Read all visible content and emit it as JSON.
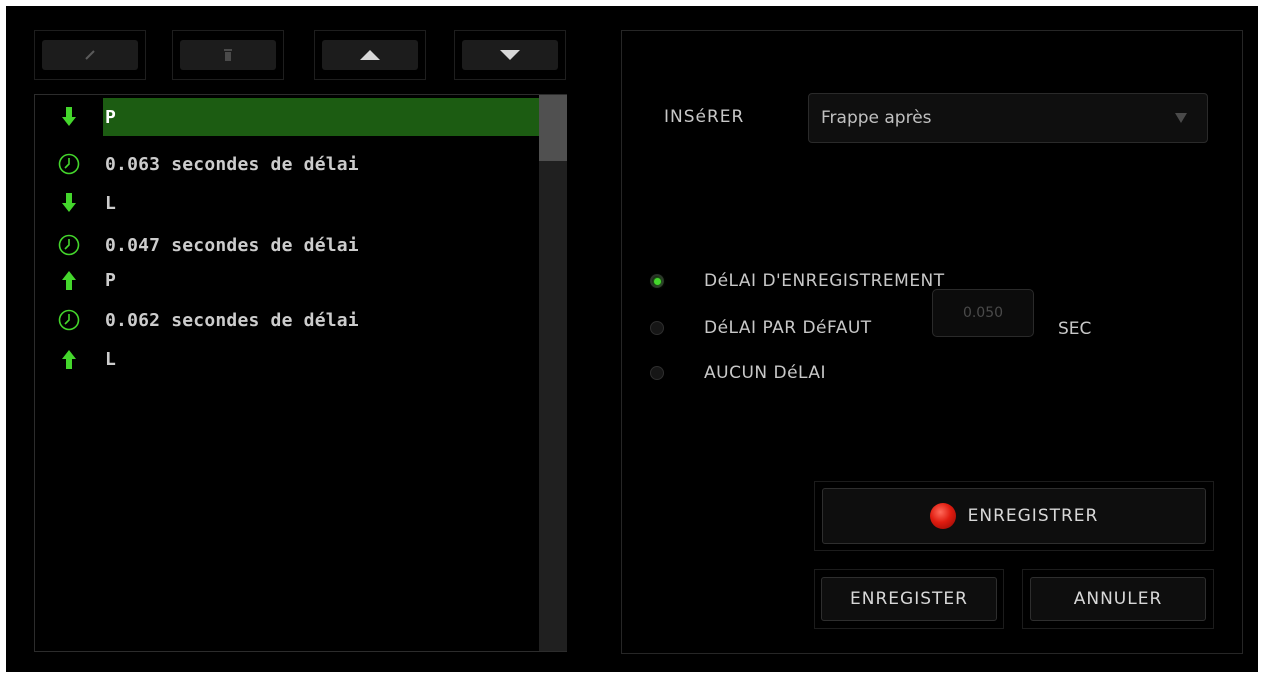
{
  "toolbar": {
    "buttons": [
      {
        "name": "edit",
        "icon": "pencil-icon"
      },
      {
        "name": "delete",
        "icon": "trash-icon"
      },
      {
        "name": "move-up",
        "icon": "arrow-up-icon"
      },
      {
        "name": "move-down",
        "icon": "arrow-down-icon"
      }
    ]
  },
  "macro_list": {
    "items": [
      {
        "icon": "key-down-arrow-icon",
        "text": "P",
        "selected": true
      },
      {
        "icon": "clock-icon",
        "text": "0.063 secondes de délai",
        "selected": false
      },
      {
        "icon": "key-down-arrow-icon",
        "text": "L",
        "selected": false
      },
      {
        "icon": "clock-icon",
        "text": "0.047 secondes de délai",
        "selected": false
      },
      {
        "icon": "key-up-arrow-icon",
        "text": "P",
        "selected": false
      },
      {
        "icon": "clock-icon",
        "text": "0.062 secondes de délai",
        "selected": false
      },
      {
        "icon": "key-up-arrow-icon",
        "text": "L",
        "selected": false
      }
    ]
  },
  "insert": {
    "label": "INSéRER",
    "selected": "Frappe après"
  },
  "delay_options": {
    "record_label": "DéLAI D'ENREGISTREMENT",
    "default_label": "DéLAI PAR DéFAUT",
    "none_label": "AUCUN DéLAI",
    "selected": "record",
    "default_value": "0.050",
    "unit": "SEC"
  },
  "actions": {
    "record_label": "ENREGISTRER",
    "save_label": "ENREGISTER",
    "cancel_label": "ANNULER"
  },
  "colors": {
    "accent_green": "#44d62c",
    "selected_row": "#1c5c12",
    "record_red": "#e01c10"
  }
}
